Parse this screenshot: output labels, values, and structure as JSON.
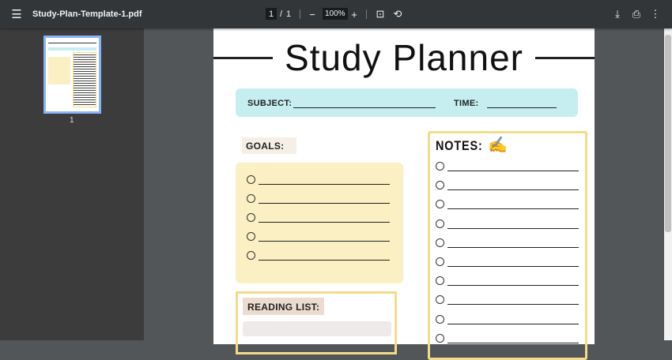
{
  "toolbar": {
    "filename": "Study-Plan-Template-1.pdf",
    "page_current": "1",
    "page_sep": "/",
    "page_total": "1",
    "zoom": "100%",
    "menu_icon": "☰",
    "zoom_out": "−",
    "zoom_in": "+",
    "fit_icon": "⊡",
    "rotate_icon": "⟲",
    "download_icon": "⤓",
    "print_icon": "⎙",
    "more_icon": "⋮"
  },
  "sidebar": {
    "thumbnail_label": "1"
  },
  "page": {
    "title": "Study Planner",
    "subject_label": "SUBJECT:",
    "time_label": "TIME:",
    "goals_label": "GOALS:",
    "notes_label": "NOTES:",
    "notes_icon": "✍",
    "reading_label": "READING LIST:"
  },
  "colors": {
    "blue": "#c6eef0",
    "yellow": "#faf0c3",
    "border": "#f2dc8a",
    "tag": "#f5efe6",
    "reading_tag": "#ecdcd0"
  }
}
